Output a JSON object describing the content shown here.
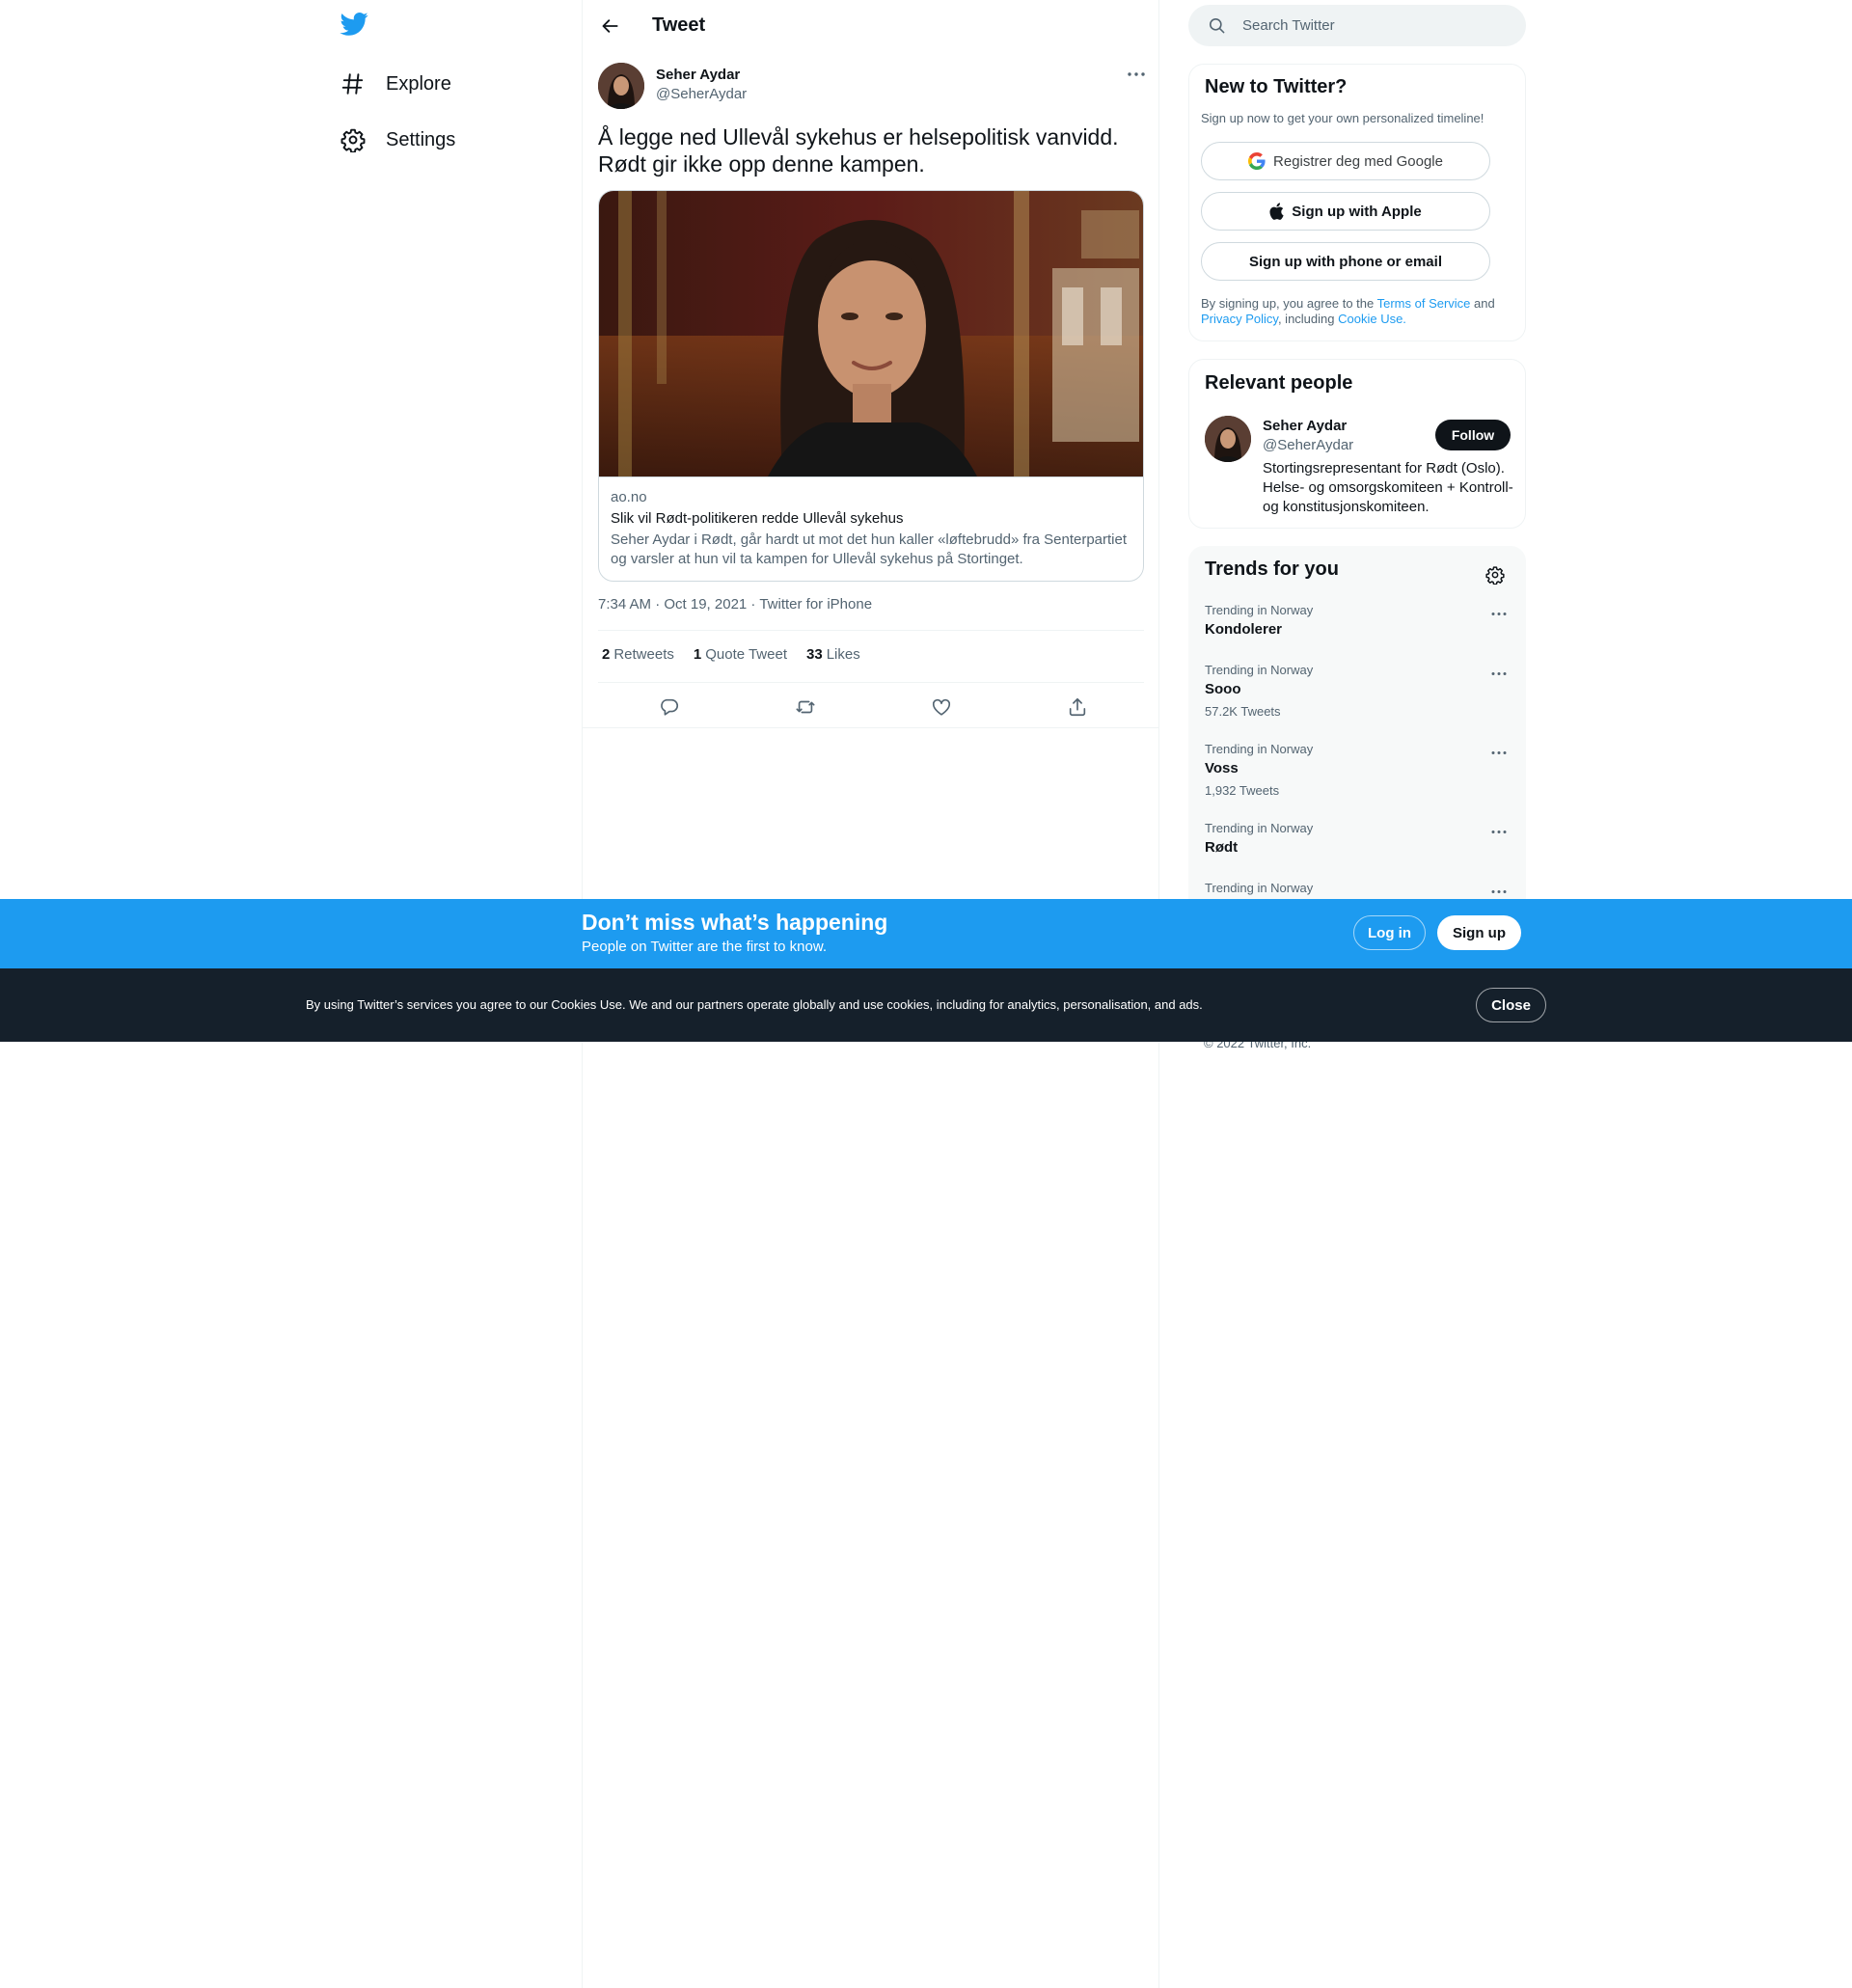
{
  "nav": {
    "logo": "twitter-bird-icon",
    "items": [
      {
        "label": "Explore",
        "icon": "hashtag-icon"
      },
      {
        "label": "Settings",
        "icon": "gear-icon"
      }
    ]
  },
  "header": {
    "title": "Tweet"
  },
  "tweet": {
    "author_name": "Seher Aydar",
    "author_handle": "@SeherAydar",
    "text_line1": "Å legge ned Ullevål sykehus er helsepolitisk vanvidd.",
    "text_line2": "Rødt gir ikke opp denne kampen.",
    "card": {
      "domain": "ao.no",
      "title": "Slik vil Rødt-politikeren redde Ullevål sykehus",
      "description": "Seher Aydar i Rødt, går hardt ut mot det hun kaller «løftebrudd» fra Senterpartiet og varsler at hun vil ta kampen for Ullevål sykehus på Stortinget."
    },
    "timestamp": "7:34 AM · Oct 19, 2021 · Twitter for iPhone",
    "stats": {
      "retweets_count": "2",
      "retweets_label": "Retweets",
      "quotes_count": "1",
      "quotes_label": "Quote Tweet",
      "likes_count": "33",
      "likes_label": "Likes"
    }
  },
  "search": {
    "placeholder": "Search Twitter"
  },
  "new_to_twitter": {
    "title": "New to Twitter?",
    "subtitle": "Sign up now to get your own personalized timeline!",
    "google_label": "Registrer deg med Google",
    "apple_label": "Sign up with Apple",
    "phone_label": "Sign up with phone or email",
    "legal_prefix": "By signing up, you agree to the ",
    "terms_link": "Terms of Service",
    "legal_and": " and ",
    "privacy_link": "Privacy Policy",
    "legal_including": ", including ",
    "cookie_link": "Cookie Use."
  },
  "relevant_people": {
    "title": "Relevant people",
    "name": "Seher Aydar",
    "handle": "@SeherAydar",
    "follow_label": "Follow",
    "bio": "Stortingsrepresentant for Rødt (Oslo). Helse- og omsorgskomiteen + Kontroll- og konstitusjonskomiteen."
  },
  "trends": {
    "title": "Trends for you",
    "items": [
      {
        "meta": "Trending in Norway",
        "name": "Kondolerer",
        "count": ""
      },
      {
        "meta": "Trending in Norway",
        "name": "Sooo",
        "count": "57.2K Tweets"
      },
      {
        "meta": "Trending in Norway",
        "name": "Voss",
        "count": "1,932 Tweets"
      },
      {
        "meta": "Trending in Norway",
        "name": "Rødt",
        "count": ""
      },
      {
        "meta": "Trending in Norway",
        "name": "",
        "count": ""
      }
    ]
  },
  "footer": {
    "copyright": "© 2022 Twitter, Inc."
  },
  "banner": {
    "title": "Don’t miss what’s happening",
    "subtitle": "People on Twitter are the first to know.",
    "login_label": "Log in",
    "signup_label": "Sign up"
  },
  "cookie": {
    "text": "By using Twitter’s services you agree to our Cookies Use. We and our partners operate globally and use cookies, including for analytics, personalisation, and ads.",
    "close_label": "Close"
  },
  "colors": {
    "accent": "#1d9bf0",
    "text": "#0f1419",
    "secondary_text": "#536471",
    "cookie_bg": "#15202b"
  }
}
